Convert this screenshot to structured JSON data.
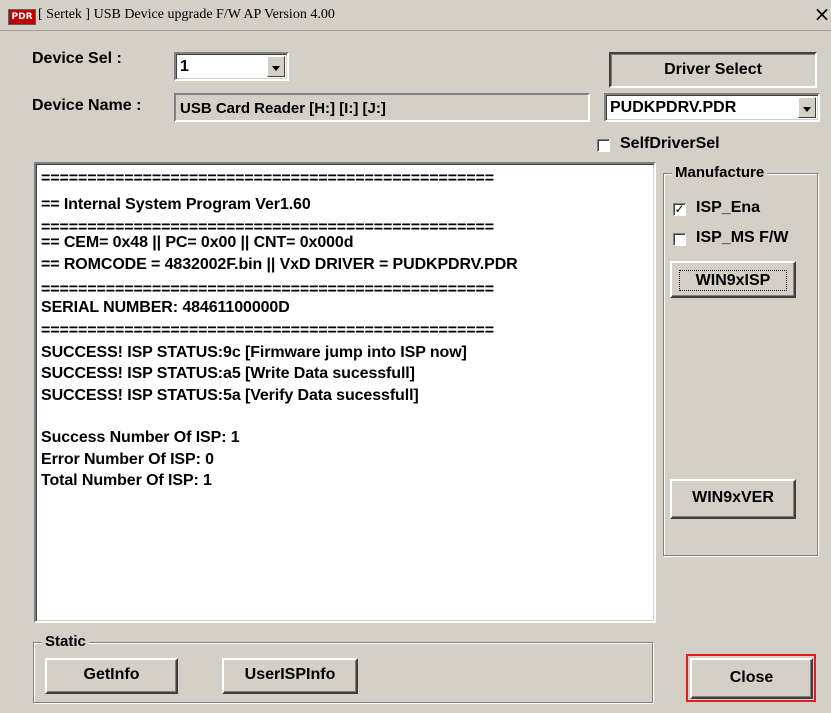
{
  "window": {
    "title": "[ Sertek ] USB Device upgrade F/W  AP  Version 4.00",
    "icon": "app-icon",
    "close_glyph": "×"
  },
  "device_sel": {
    "label": "Device Sel  :",
    "value": "1"
  },
  "device_name": {
    "label": "Device Name :",
    "value": "USB Card Reader [H:] [I:] [J:]"
  },
  "driver": {
    "select_button": "Driver Select",
    "file_value": "PUDKPDRV.PDR",
    "self_driver_sel": {
      "label": "SelfDriverSel",
      "checked": false
    }
  },
  "log": {
    "lines": [
      "=================================================",
      "==  Internal System Program Ver1.60",
      "=================================================",
      "==  CEM= 0x48 || PC= 0x00 || CNT= 0x000d",
      "==  ROMCODE = 4832002F.bin || VxD DRIVER = PUDKPDRV.PDR",
      "=================================================",
      "SERIAL NUMBER: 48461100000D",
      "=================================================",
      "SUCCESS! ISP STATUS:9c [Firmware jump into ISP now]",
      "SUCCESS! ISP STATUS:a5 [Write Data sucessfull]",
      "SUCCESS! ISP STATUS:5a [Verify Data sucessfull]",
      "",
      "Success Number Of ISP: 1",
      "Error   Number Of ISP: 0",
      "Total   Number Of ISP: 1"
    ]
  },
  "manufacture": {
    "title": "Manufacture",
    "isp_ena": {
      "label": "ISP_Ena",
      "checked": true
    },
    "isp_ms_fw": {
      "label": "ISP_MS F/W",
      "checked": false
    },
    "win9x_isp": "WIN9xISP",
    "win9x_ver": "WIN9xVER"
  },
  "static": {
    "title": "Static",
    "getinfo": "GetInfo",
    "userispinfo": "UserISPInfo"
  },
  "close_button": "Close",
  "colors": {
    "face": "#d4d0c8",
    "highlight_box": "#e02020"
  }
}
